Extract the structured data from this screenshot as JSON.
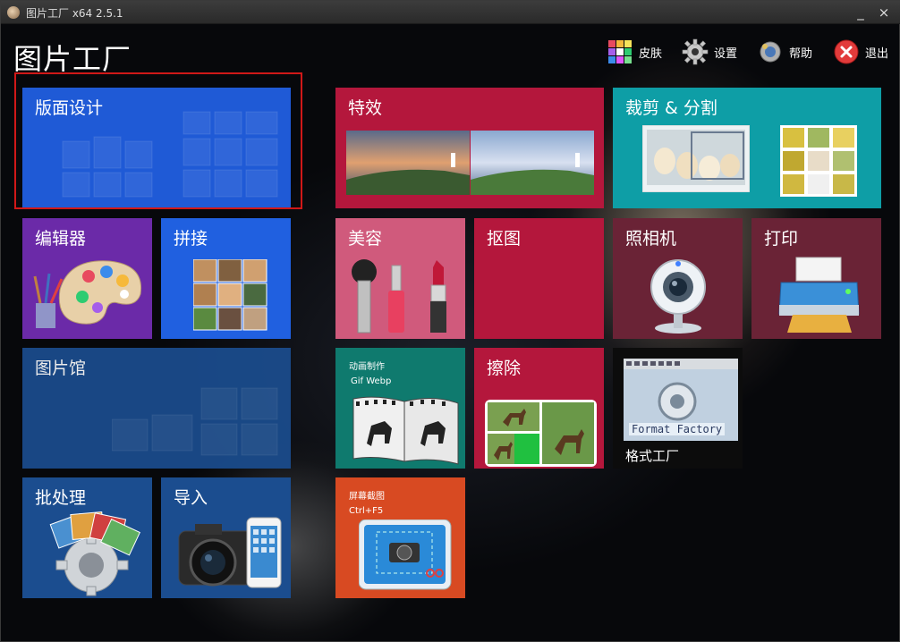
{
  "window": {
    "title": "图片工厂 x64 2.5.1",
    "minimize": "_",
    "close": "×"
  },
  "app_title": "图片工厂",
  "toolbar": {
    "skin": "皮肤",
    "settings": "设置",
    "help": "帮助",
    "exit": "退出"
  },
  "tiles": {
    "layout_design": "版面设计",
    "effects": "特效",
    "crop_split": "裁剪 & 分割",
    "editor": "编辑器",
    "collage": "拼接",
    "beauty": "美容",
    "cutout": "抠图",
    "camera": "照相机",
    "print": "打印",
    "gallery": "图片馆",
    "animation_line1": "动画制作",
    "animation_line2": "Gif Webp",
    "erase": "擦除",
    "format_factory_logo": "Format Factory",
    "format_factory": "格式工厂",
    "batch": "批处理",
    "import": "导入",
    "screenshot_line1": "屏幕截图",
    "screenshot_line2": "Ctrl+F5"
  },
  "colors": {
    "blue_tile": "#1f5ad6",
    "bright_blue_tile": "#2060e0",
    "purple_tile": "#6b2aa8",
    "crimson_tile": "#b4173c",
    "pink_tile": "#d05a7c",
    "teal_tile": "#0e9ea6",
    "maroon_tile": "#6a2336",
    "green_teal_tile": "#0f7a6e",
    "orange_tile": "#d84a22",
    "navy_tile": "#1b4d8f",
    "selection_border": "#d01818"
  }
}
